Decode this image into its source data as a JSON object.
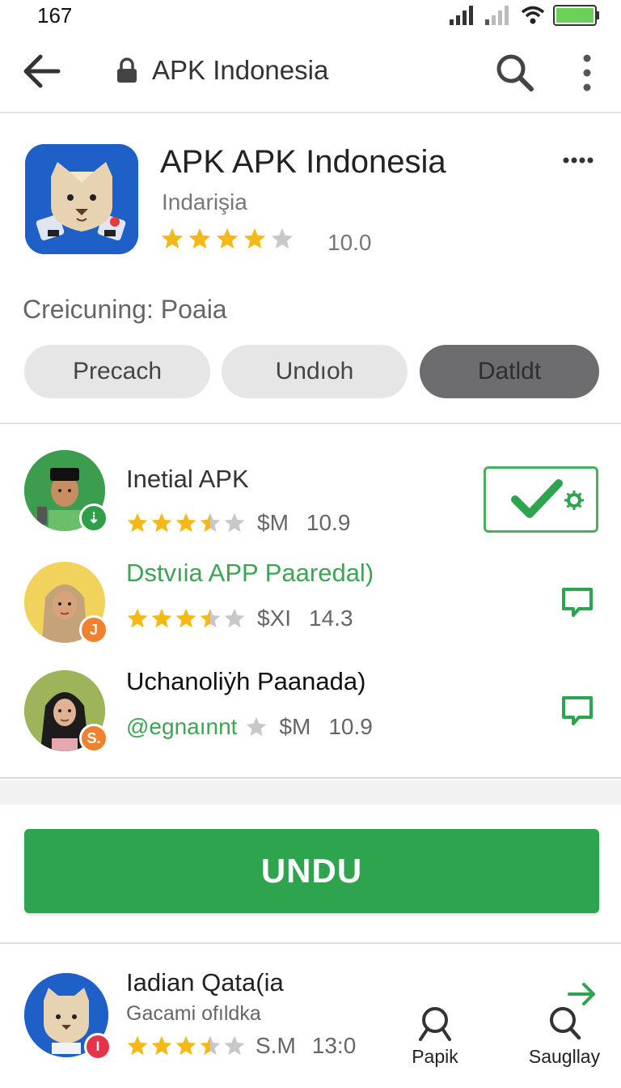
{
  "status_bar": {
    "time": "167"
  },
  "toolbar": {
    "title": "APK Indonesia"
  },
  "app": {
    "title": "APK APK Indonesia",
    "subtitle": "Indarişia",
    "stars_filled": 4,
    "stars_total": 5,
    "rating": "10.0",
    "status": "Creicuning: Poaia",
    "buttons": [
      "Precach",
      "Undıoh",
      "Datldt"
    ]
  },
  "list": [
    {
      "title": "Inetial APK",
      "title_color": "#444444",
      "stars_filled": 3.5,
      "price": "$M",
      "score": "10.9",
      "handle": "",
      "badge": "⇣",
      "badge_color": "#2e9e47",
      "action": "check-settings"
    },
    {
      "title": "Dstvıia APP Paaredal)",
      "title_color": "#3aa651",
      "stars_filled": 3.5,
      "price": "$XI",
      "score": "14.3",
      "handle": "",
      "badge": "J",
      "badge_color": "#f0822f",
      "action": "chat"
    },
    {
      "title": "Uchanoliẏh Paanada)",
      "title_color": "#111111",
      "stars_filled": 0,
      "price": "$M",
      "score": "10.9",
      "handle": "@egnaınnt",
      "badge": "S.",
      "badge_color": "#f0822f",
      "action": "chat"
    }
  ],
  "cta": {
    "label": "UNDU"
  },
  "bottom": {
    "title": "Iadian Qata(ia",
    "subtitle": "Gacami ofıldka",
    "stars_filled": 3.5,
    "price": "S.M",
    "score": "13:0",
    "nav": [
      {
        "label": "Papik",
        "icon": "search-icon"
      },
      {
        "label": "Saugllay",
        "icon": "search-icon"
      }
    ]
  },
  "colors": {
    "accent": "#2ea44f",
    "star": "#f5b915",
    "star_empty": "#c8c8c8",
    "app_icon_bg": "#1f5fc8"
  }
}
